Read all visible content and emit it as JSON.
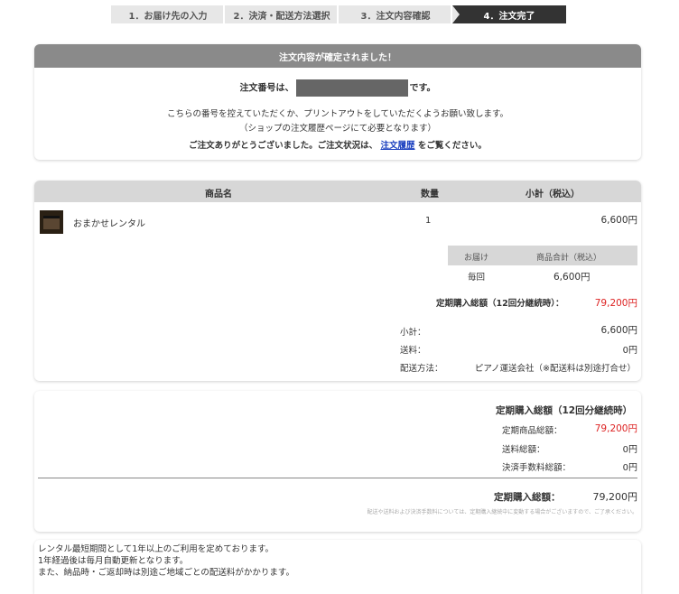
{
  "steps": [
    "1．お届け先の入力",
    "2．決済・配送方法選択",
    "3．注文内容確認",
    "4．注文完了"
  ],
  "confirm": {
    "header": "注文内容が確定されました！",
    "order_prefix": "注文番号は、",
    "order_suffix": "です。",
    "note1": "こちらの番号を控えていただくか、プリントアウトをしていただくようお願い致します。",
    "note2": "（ショップの注文履歴ページにて必要となります）",
    "thanks_prefix": "ご注文ありがとうございました。ご注文状況は、",
    "history_link": "注文履歴",
    "thanks_suffix": "をご覧ください。"
  },
  "table": {
    "col_product": "商品名",
    "col_qty": "数量",
    "col_subtotal": "小計（税込）",
    "item": {
      "name": "おまかせレンタル",
      "qty": "1",
      "price": "6,600円"
    },
    "delivery_head": "お届け",
    "total_head": "商品合計（税込）",
    "delivery_val": "毎回",
    "total_val": "6,600円",
    "periodic_label": "定期購入総額（12回分継続時）：",
    "periodic_val": "79,200円",
    "subtotal_label": "小計：",
    "subtotal_val": "6,600円",
    "shipping_label": "送料：",
    "shipping_val": "0円",
    "method_label": "配送方法：",
    "method_val": "ピアノ運送会社（※配送料は別途打合せ）"
  },
  "summary": {
    "title": "定期購入総額（12回分継続時）",
    "goods_label": "定期商品総額：",
    "goods_val": "79,200円",
    "shipping_label": "送料総額：",
    "shipping_val": "0円",
    "fee_label": "決済手数料総額：",
    "fee_val": "0円",
    "grand_label": "定期購入総額：",
    "grand_val": "79,200円",
    "notice": "配送や送料および決済手数料については、定期購入継続中に変動する場合がございますので、ご了承ください。"
  },
  "info": {
    "line1": "レンタル最短期間として1年以上のご利用を定めております。",
    "line2": "1年経過後は毎月自動更新となります。",
    "line3": "また、納品時・ご返却時は別途ご地域ごとの配送料がかかります。"
  }
}
